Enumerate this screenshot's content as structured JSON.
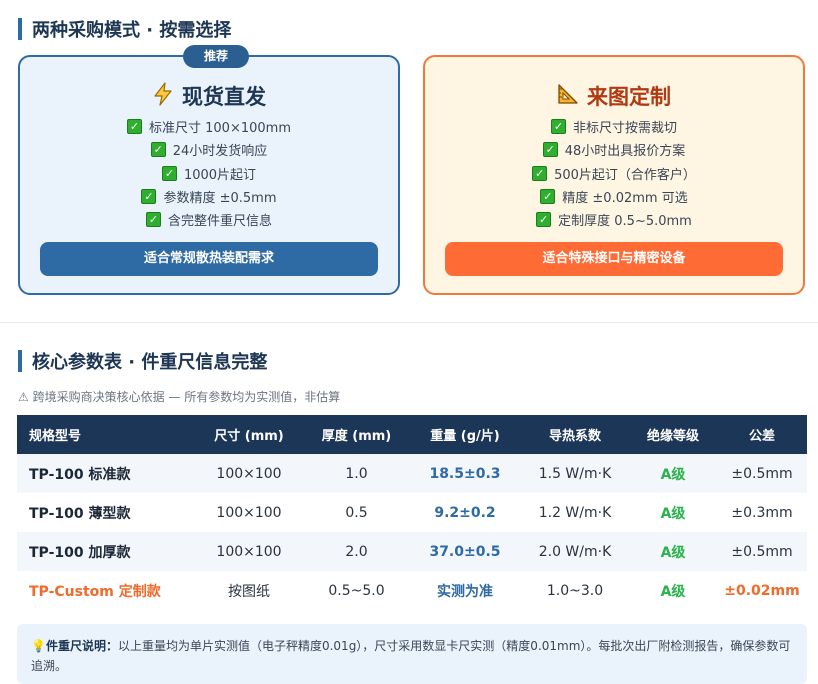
{
  "section1": {
    "title": "两种采购模式 · 按需选择"
  },
  "stock": {
    "badge": "推荐",
    "title": "现货直发",
    "features": [
      "标准尺寸 100×100mm",
      "24小时发货响应",
      "1000片起订",
      "参数精度 ±0.5mm",
      "含完整件重尺信息"
    ],
    "cta": "适合常规散热装配需求",
    "icon": "lightning-icon"
  },
  "custom": {
    "title": "来图定制",
    "features": [
      "非标尺寸按需裁切",
      "48小时出具报价方案",
      "500片起订（合作客户）",
      "精度 ±0.02mm 可选",
      "定制厚度 0.5~5.0mm"
    ],
    "cta": "适合特殊接口与精密设备",
    "icon": "triangle-ruler-icon"
  },
  "section2": {
    "title": "核心参数表 · 件重尺信息完整",
    "note": "⚠ 跨境采购商决策核心依据 — 所有参数均为实测值，非估算"
  },
  "table": {
    "headers": [
      "规格型号",
      "尺寸 (mm)",
      "厚度 (mm)",
      "重量 (g/片)",
      "导热系数",
      "绝缘等级",
      "公差"
    ],
    "rows": [
      [
        "TP-100 标准款",
        "100×100",
        "1.0",
        "18.5±0.3",
        "1.5 W/m·K",
        "A级",
        "±0.5mm"
      ],
      [
        "TP-100 薄型款",
        "100×100",
        "0.5",
        "9.2±0.2",
        "1.2 W/m·K",
        "A级",
        "±0.3mm"
      ],
      [
        "TP-100 加厚款",
        "100×100",
        "2.0",
        "37.0±0.5",
        "2.0 W/m·K",
        "A级",
        "±0.5mm"
      ],
      [
        "TP-Custom 定制款",
        "按图纸",
        "0.5~5.0",
        "实测为准",
        "1.0~3.0",
        "A级",
        "±0.02mm"
      ]
    ]
  },
  "info": {
    "label": "件重尺说明：",
    "text": "以上重量均为单片实测值（电子秤精度0.01g），尺寸采用数显卡尺实测（精度0.01mm）。每批次出厂附检测报告，确保参数可追溯。"
  },
  "colors": {
    "primary": "#2e6aa3",
    "accent": "#ff6b35",
    "header": "#1c3658",
    "grade": "#2bb24c"
  }
}
